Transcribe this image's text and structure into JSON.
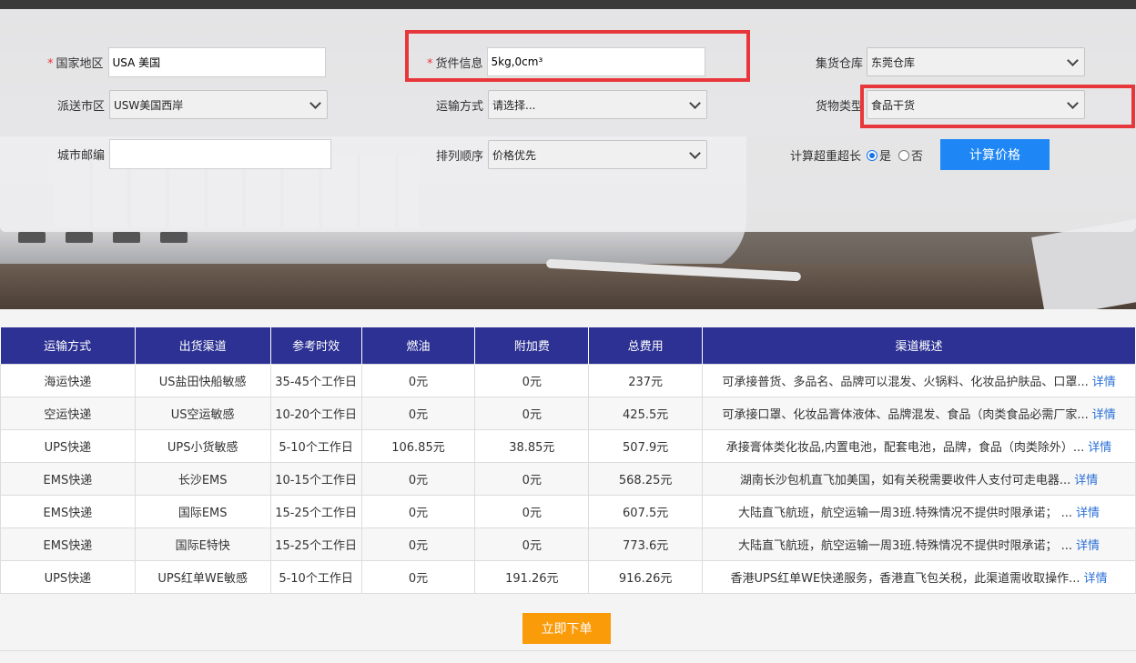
{
  "form": {
    "country_label": "国家地区",
    "country_value": "USA 美国",
    "cargo_label": "货件信息",
    "cargo_value": "5kg,0cm³",
    "warehouse_label": "集货仓库",
    "warehouse_value": "东莞仓库",
    "city_area_label": "派送市区",
    "city_area_value": "USW美国西岸",
    "shipping_method_label": "运输方式",
    "shipping_method_value": "请选择...",
    "goods_type_label": "货物类型",
    "goods_type_value": "食品干货",
    "postcode_label": "城市邮编",
    "postcode_value": "",
    "sort_label": "排列顺序",
    "sort_value": "价格优先",
    "oversize_label": "计算超重超长",
    "oversize_yes": "是",
    "oversize_no": "否",
    "calc_button": "计算价格"
  },
  "table": {
    "headers": [
      "运输方式",
      "出货渠道",
      "参考时效",
      "燃油",
      "附加费",
      "总费用",
      "渠道概述"
    ],
    "detail_label": "详情",
    "rows": [
      [
        "海运快递",
        "US盐田快船敏感",
        "35-45个工作日",
        "0元",
        "0元",
        "237元",
        "可承接普货、多品名、品牌可以混发、火锅料、化妆品护肤品、口罩..."
      ],
      [
        "空运快递",
        "US空运敏感",
        "10-20个工作日",
        "0元",
        "0元",
        "425.5元",
        "可承接口罩、化妆品膏体液体、品牌混发、食品（肉类食品必需厂家..."
      ],
      [
        "UPS快递",
        "UPS小货敏感",
        "5-10个工作日",
        "106.85元",
        "38.85元",
        "507.9元",
        "承接膏体类化妆品,内置电池，配套电池，品牌，食品（肉类除外）..."
      ],
      [
        "EMS快递",
        "长沙EMS",
        "10-15个工作日",
        "0元",
        "0元",
        "568.25元",
        "湖南长沙包机直飞加美国，如有关税需要收件人支付可走电器..."
      ],
      [
        "EMS快递",
        "国际EMS",
        "15-25个工作日",
        "0元",
        "0元",
        "607.5元",
        "大陆直飞航班，航空运输一周3班.特殊情况不提供时限承诺；  ..."
      ],
      [
        "EMS快递",
        "国际E特快",
        "15-25个工作日",
        "0元",
        "0元",
        "773.6元",
        "大陆直飞航班，航空运输一周3班.特殊情况不提供时限承诺；  ..."
      ],
      [
        "UPS快递",
        "UPS红单WE敏感",
        "5-10个工作日",
        "0元",
        "191.26元",
        "916.26元",
        "香港UPS红单WE快递服务，香港直飞包关税，此渠道需收取操作..."
      ]
    ]
  },
  "order_button": "立即下单",
  "colors": {
    "header_bg": "#2c3193",
    "calc_button": "#1f86f5",
    "order_button": "#fa9b0a",
    "highlight": "#e8373a",
    "link": "#2a6fd6"
  }
}
